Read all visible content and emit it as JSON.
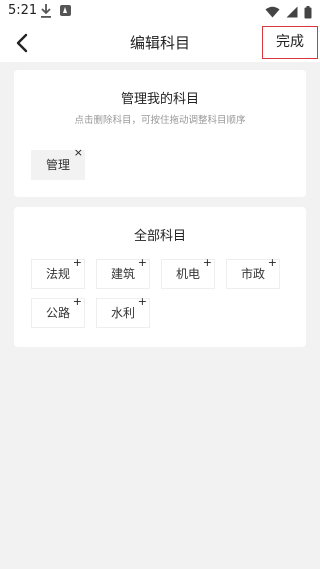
{
  "status_bar": {
    "time": "5:21",
    "icons": [
      "download-icon",
      "app-a-icon",
      "wifi-icon",
      "signal-icon",
      "battery-icon"
    ]
  },
  "nav": {
    "title": "编辑科目",
    "back_icon": "chevron-left-icon",
    "done_label": "完成"
  },
  "my_subjects": {
    "title": "管理我的科目",
    "hint": "点击删除科目，可按住拖动调整科目顺序",
    "items": [
      {
        "label": "管理",
        "action_icon": "×"
      }
    ]
  },
  "all_subjects": {
    "title": "全部科目",
    "items": [
      {
        "label": "法规",
        "action_icon": "+"
      },
      {
        "label": "建筑",
        "action_icon": "+"
      },
      {
        "label": "机电",
        "action_icon": "+"
      },
      {
        "label": "市政",
        "action_icon": "+"
      },
      {
        "label": "公路",
        "action_icon": "+"
      },
      {
        "label": "水利",
        "action_icon": "+"
      }
    ]
  },
  "colors": {
    "background": "#f2f2f2",
    "card": "#ffffff",
    "highlight_border": "#d9363e",
    "hint_text": "#999999"
  }
}
